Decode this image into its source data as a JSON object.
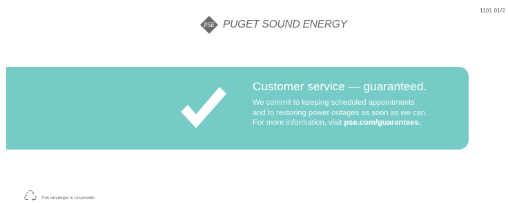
{
  "header": {
    "doc_code": "1101 01/2"
  },
  "logo": {
    "mark_text": "PSE",
    "company_name": "PUGET SOUND ENERGY"
  },
  "banner": {
    "title": "Customer service — guaranteed.",
    "body_line1": "We commit to keeping scheduled appointments",
    "body_line2": "and to restoring power outages as soon as we can.",
    "body_line3_prefix": "For more information, visit ",
    "link_text": "pse.com/guarantees.",
    "background_color": "#76cbc6",
    "icon": "checkmark-icon"
  },
  "footer": {
    "recycle_text": "This envelope is recyclable",
    "icon": "recycle-icon"
  }
}
